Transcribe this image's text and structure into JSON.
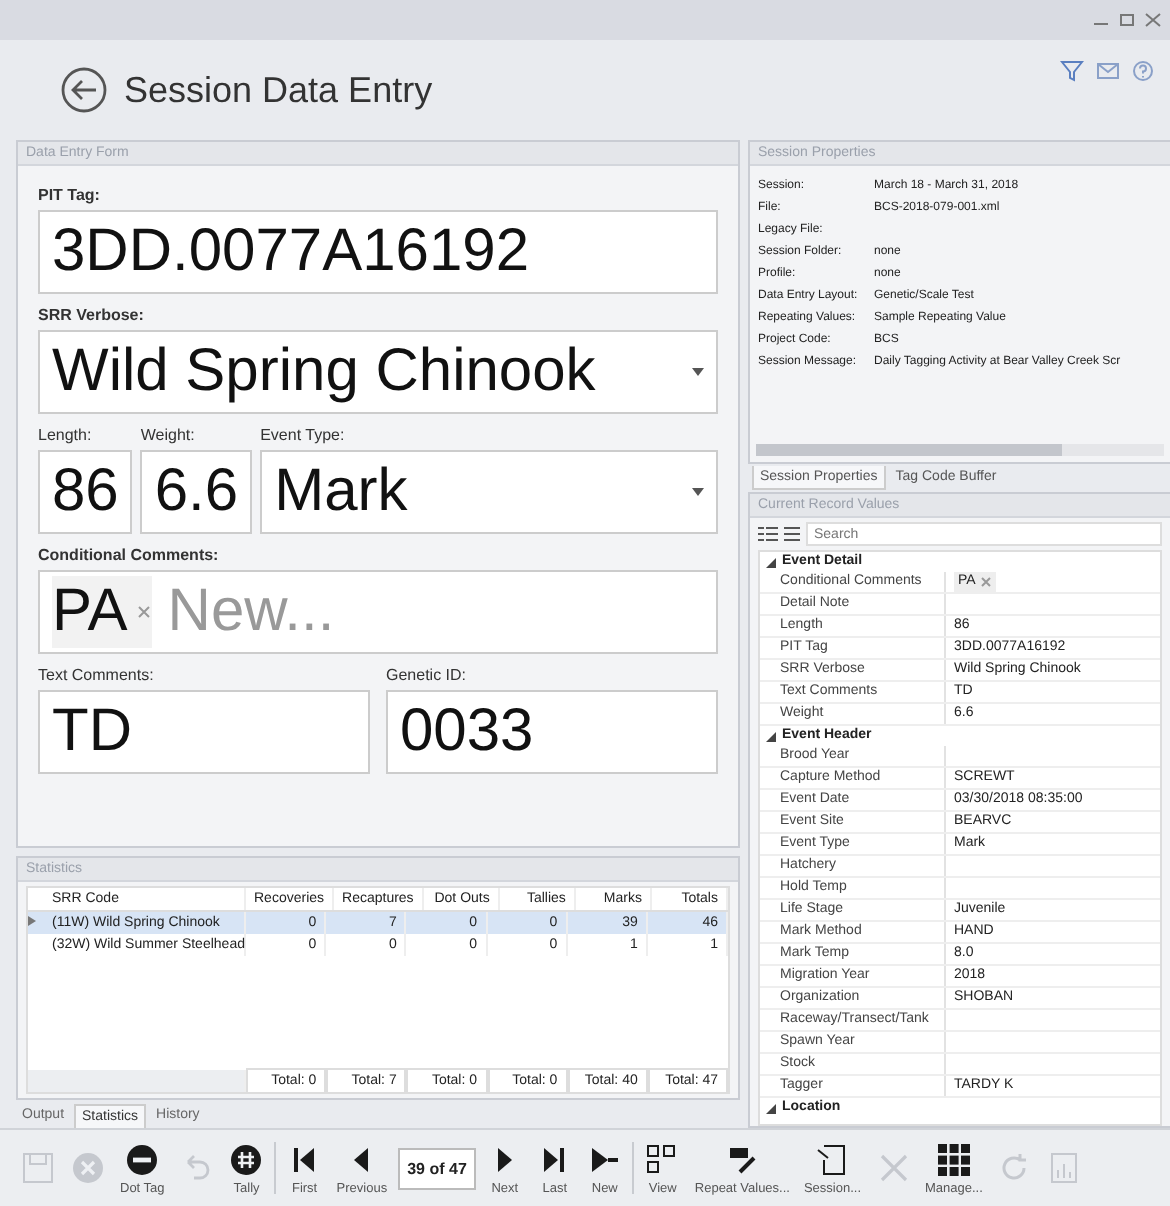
{
  "header": {
    "title": "Session Data Entry"
  },
  "form": {
    "title": "Data Entry Form",
    "pit_tag": {
      "label": "PIT Tag:",
      "value": "3DD.0077A16192"
    },
    "srr_verbose": {
      "label": "SRR Verbose:",
      "value": "Wild Spring Chinook"
    },
    "length": {
      "label": "Length:",
      "value": "86"
    },
    "weight": {
      "label": "Weight:",
      "value": "6.6"
    },
    "event_type": {
      "label": "Event Type:",
      "value": "Mark"
    },
    "conditional_comments": {
      "label": "Conditional Comments:",
      "tokens": [
        "PA"
      ],
      "placeholder": "New..."
    },
    "text_comments": {
      "label": "Text Comments:",
      "value": "TD"
    },
    "genetic_id": {
      "label": "Genetic ID:",
      "value": "0033"
    }
  },
  "session_properties": {
    "title": "Session Properties",
    "rows": [
      {
        "label": "Session:",
        "value": "March 18 - March 31, 2018"
      },
      {
        "label": "File:",
        "value": "BCS-2018-079-001.xml"
      },
      {
        "label": "Legacy File:"
      },
      {
        "label": "Session Folder:",
        "value": "none"
      },
      {
        "label": "Profile:",
        "value": "none"
      },
      {
        "label": "Data Entry Layout:",
        "value": "Genetic/Scale Test"
      },
      {
        "label": "Repeating Values:",
        "value": "Sample Repeating Value"
      },
      {
        "label": "Project Code:",
        "value": "BCS"
      },
      {
        "label": "Session Message:",
        "value": "Daily Tagging Activity at Bear Valley Creek Scr"
      }
    ],
    "tabs": [
      {
        "label": "Session Properties",
        "selected": true
      },
      {
        "label": "Tag Code Buffer",
        "selected": false
      }
    ]
  },
  "current_record": {
    "title": "Current Record Values",
    "search": {
      "placeholder": "Search"
    },
    "groups": [
      {
        "name": "Event Detail",
        "expanded": true,
        "rows": [
          {
            "label": "Conditional Comments",
            "value": "PA",
            "kind": "token"
          },
          {
            "label": "Detail Note",
            "kind": "text"
          },
          {
            "label": "Length",
            "value": "86",
            "kind": "text"
          },
          {
            "label": "PIT Tag",
            "value": "3DD.0077A16192",
            "kind": "text"
          },
          {
            "label": "SRR Verbose",
            "value": "Wild Spring Chinook",
            "kind": "text"
          },
          {
            "label": "Text Comments",
            "value": "TD",
            "kind": "text"
          },
          {
            "label": "Weight",
            "value": "6.6",
            "kind": "text"
          }
        ]
      },
      {
        "name": "Event Header",
        "expanded": true,
        "rows": [
          {
            "label": "Brood Year",
            "kind": "text"
          },
          {
            "label": "Capture Method",
            "value": "SCREWT",
            "kind": "text"
          },
          {
            "label": "Event Date",
            "value": "03/30/2018 08:35:00",
            "kind": "text"
          },
          {
            "label": "Event Site",
            "value": "BEARVC",
            "kind": "text"
          },
          {
            "label": "Event Type",
            "value": "Mark",
            "kind": "text"
          },
          {
            "label": "Hatchery",
            "kind": "text"
          },
          {
            "label": "Hold Temp",
            "kind": "text"
          },
          {
            "label": "Life Stage",
            "value": "Juvenile",
            "kind": "text"
          },
          {
            "label": "Mark Method",
            "value": "HAND",
            "kind": "text"
          },
          {
            "label": "Mark Temp",
            "value": "8.0",
            "kind": "text"
          },
          {
            "label": "Migration Year",
            "value": "2018",
            "kind": "text"
          },
          {
            "label": "Organization",
            "value": "SHOBAN",
            "kind": "text"
          },
          {
            "label": "Raceway/Transect/Tank",
            "kind": "text"
          },
          {
            "label": "Spawn Year",
            "kind": "text"
          },
          {
            "label": "Stock",
            "kind": "text"
          },
          {
            "label": "Tagger",
            "value": "TARDY K",
            "kind": "text"
          }
        ]
      },
      {
        "name": "Location",
        "expanded": true
      }
    ]
  },
  "statistics": {
    "title": "Statistics",
    "columns": [
      "SRR Code",
      "Recoveries",
      "Recaptures",
      "Dot Outs",
      "Tallies",
      "Marks",
      "Totals"
    ],
    "rows": [
      {
        "cells": [
          "(11W) Wild Spring Chinook",
          "0",
          "7",
          "0",
          "0",
          "39",
          "46"
        ],
        "selected": true
      },
      {
        "cells": [
          "(32W) Wild Summer Steelhead",
          "0",
          "0",
          "0",
          "0",
          "1",
          "1"
        ],
        "selected": false
      }
    ],
    "totals": [
      "Total: 0",
      "Total: 7",
      "Total: 0",
      "Total: 0",
      "Total: 40",
      "Total: 47"
    ]
  },
  "bottom_tabs": [
    {
      "label": "Output",
      "selected": false
    },
    {
      "label": "Statistics",
      "selected": true
    },
    {
      "label": "History",
      "selected": false
    }
  ],
  "toolbar": [
    {
      "kind": "save",
      "disabled": true
    },
    {
      "kind": "reject",
      "disabled": true
    },
    {
      "kind": "dot",
      "label": "Dot Tag",
      "disabled": false
    },
    {
      "kind": "undo",
      "disabled": true
    },
    {
      "kind": "tally",
      "label": "Tally",
      "disabled": false
    },
    {
      "kind": "separator"
    },
    {
      "kind": "first",
      "label": "First",
      "disabled": false
    },
    {
      "kind": "previous",
      "label": "Previous",
      "disabled": false
    },
    {
      "kind": "counter",
      "label": "39 of 47"
    },
    {
      "kind": "next",
      "label": "Next",
      "disabled": false
    },
    {
      "kind": "last",
      "label": "Last",
      "disabled": false
    },
    {
      "kind": "new",
      "label": "New",
      "disabled": false
    },
    {
      "kind": "separator"
    },
    {
      "kind": "view",
      "label": "View",
      "disabled": false
    },
    {
      "kind": "repeat",
      "label": "Repeat Values...",
      "disabled": false
    },
    {
      "kind": "session",
      "label": "Session...",
      "disabled": false
    },
    {
      "kind": "cut",
      "disabled": true
    },
    {
      "kind": "manage",
      "label": "Manage...",
      "disabled": false
    },
    {
      "kind": "refresh",
      "disabled": true
    },
    {
      "kind": "report",
      "disabled": true
    }
  ]
}
